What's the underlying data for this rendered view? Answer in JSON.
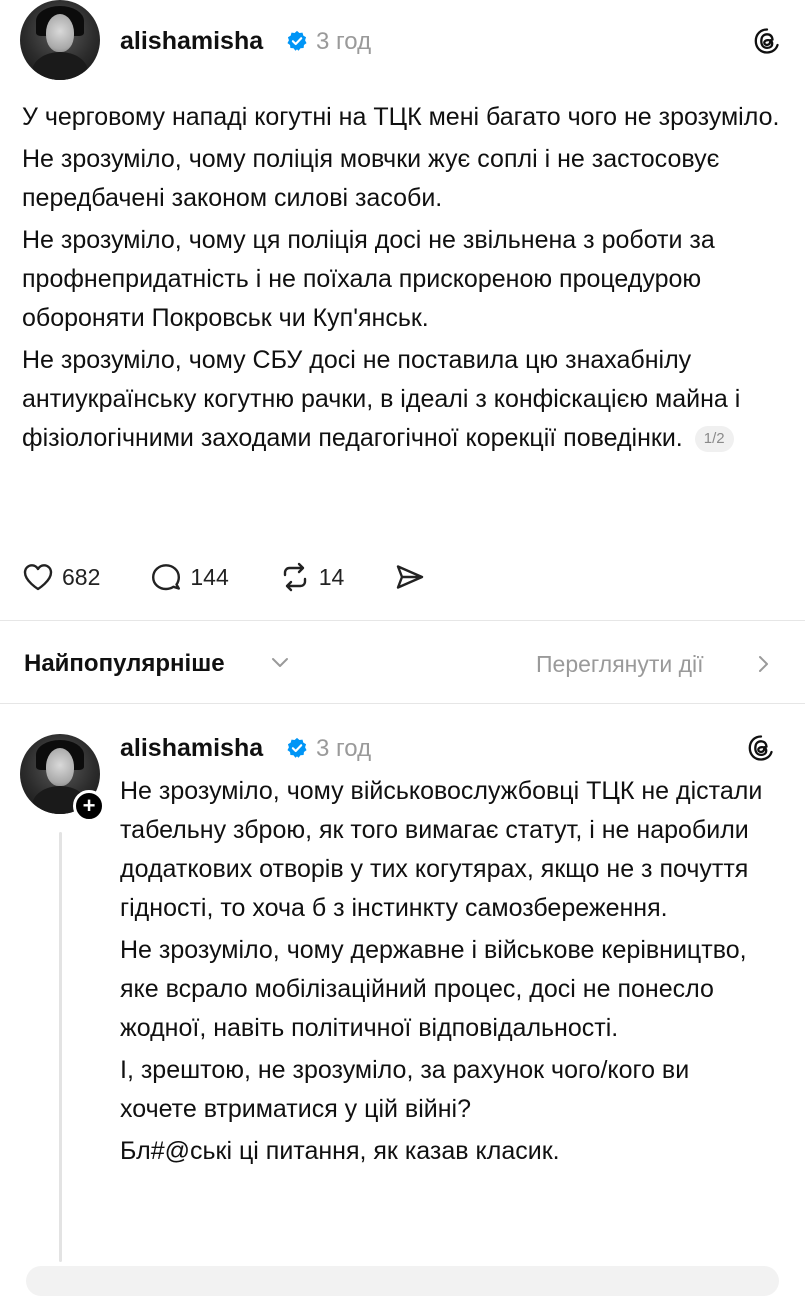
{
  "post1": {
    "username": "alishamisha",
    "time": "3 год",
    "paragraphs": [
      "У черговому нападі когутні на ТЦК мені багато чого не зрозуміло.",
      "Не зрозуміло, чому поліція мовчки жує соплі і не застосовує передбачені законом силові засоби.",
      "Не зрозуміло,  чому ця поліція досі не звільнена з роботи за профнепридатність і не поїхала прискореною процедурою обороняти Покровськ чи Куп'янськ.",
      "Не зрозуміло, чому СБУ досі не поставила цю знахабнілу антиукраїнську когутню рачки, в ідеалі з конфіскацією майна і фізіологічними заходами педагогічної корекції поведінки."
    ],
    "pager": "1/2",
    "likes": "682",
    "comments": "144",
    "reposts": "14"
  },
  "sort": {
    "label": "Найпопулярніше",
    "activity_link": "Переглянути дії"
  },
  "post2": {
    "username": "alishamisha",
    "time": "3 год",
    "paragraphs": [
      "Не зрозуміло, чому військовослужбовці ТЦК не дістали табельну зброю, як того вимагає статут, і не наробили додаткових отворів у тих когутярах, якщо не з почуття гідності,  то хоча б з інстинкту самозбереження.",
      "Не зрозуміло,  чому державне і військове керівництво, яке всрало мобілізаційний процес, досі не понесло жодної, навіть політичної відповідальності.",
      "І, зрештою,  не зрозуміло, за рахунок чого/кого ви хочете втриматися у цій війні?",
      "Бл#@ські ці питання, як казав класик."
    ]
  },
  "colors": {
    "verified": "#0095f6",
    "muted": "#9a9a9a"
  }
}
